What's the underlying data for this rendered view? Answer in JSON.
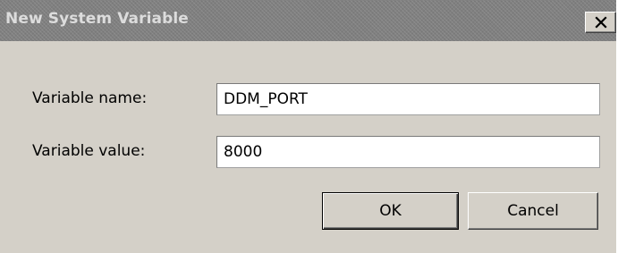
{
  "dialog": {
    "title": "New System Variable",
    "close_glyph": "✕"
  },
  "fields": {
    "name_label": "Variable name:",
    "name_value": "DDM_PORT",
    "value_label": "Variable value:",
    "value_value": "8000"
  },
  "buttons": {
    "ok_label": "OK",
    "cancel_label": "Cancel"
  },
  "colors": {
    "titlebar": "#808080",
    "title_text": "#dcdcdc",
    "client": "#d4d0c8"
  }
}
